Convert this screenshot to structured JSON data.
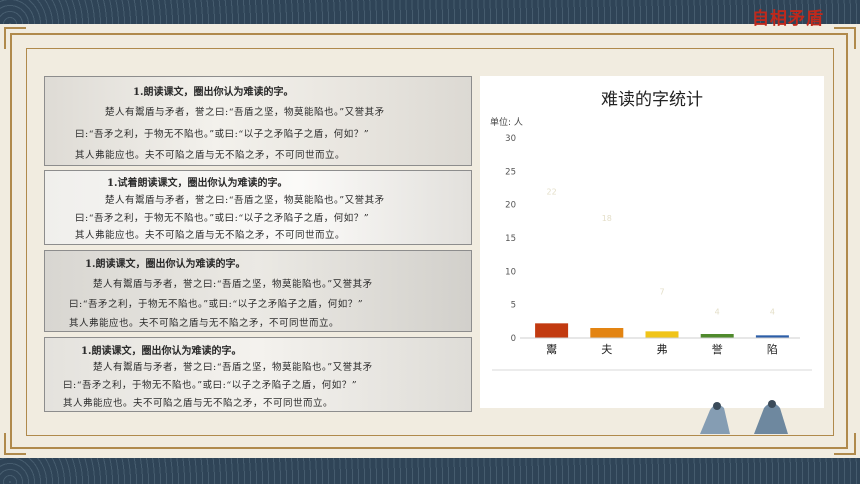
{
  "header": {
    "title": "自相矛盾"
  },
  "scans": [
    {
      "question": "1.朗读课文，圈出你认为难读的字。",
      "line1": "楚人有鬻盾与矛者，誉之曰:“吾盾之坚，物莫能陷也。”又誉其矛",
      "line2": "曰:“吾矛之利，于物无不陷也。”或曰:“以子之矛陷子之盾，何如？”",
      "line3": "其人弗能应也。夫不可陷之盾与无不陷之矛，不可同世而立。"
    },
    {
      "question": "1.试着朗读课文，圈出你认为难读的字。",
      "line1": "楚人有鬻盾与矛者，誉之曰:“吾盾之坚，物莫能陷也。”又誉其矛",
      "line2": "曰:“吾矛之利，于物无不陷也。”或曰:“以子之矛陷子之盾，何如？”",
      "line3": "其人弗能应也。夫不可陷之盾与无不陷之矛，不可同世而立。"
    },
    {
      "question": "1.朗读课文，圈出你认为难读的字。",
      "line1": "楚人有鬻盾与矛者，誉之曰:“吾盾之坚，物莫能陷也。”又誉其矛",
      "line2": "曰:“吾矛之利，于物无不陷也。”或曰:“以子之矛陷子之盾，何如？”",
      "line3": "其人弗能应也。夫不可陷之盾与无不陷之矛，不可同世而立。"
    },
    {
      "question": "1.朗读课文，圈出你认为难读的字。",
      "line1": "楚人有鬻盾与矛者，誉之曰:“吾盾之坚，物莫能陷也。”又誉其矛",
      "line2": "曰:“吾矛之利，于物无不陷也。”或曰:“以子之矛陷子之盾，何如？”",
      "line3": "其人弗能应也。夫不可陷之盾与无不陷之矛，不可同世而立。"
    }
  ],
  "chart_data": {
    "type": "bar",
    "title": "难读的字统计",
    "unit_label": "单位: 人",
    "categories": [
      "鬻",
      "夫",
      "弗",
      "誉",
      "陷"
    ],
    "values": [
      2.2,
      1.5,
      1.0,
      0.6,
      0.4
    ],
    "data_labels": [
      "22",
      "18",
      "7",
      "4",
      "4"
    ],
    "colors": [
      "#c23a10",
      "#e38412",
      "#f0c419",
      "#4f8a2c",
      "#2c5ea8"
    ],
    "ylim": [
      0,
      30
    ],
    "yticks": [
      0,
      5,
      10,
      15,
      20,
      25,
      30
    ],
    "grid": false
  }
}
